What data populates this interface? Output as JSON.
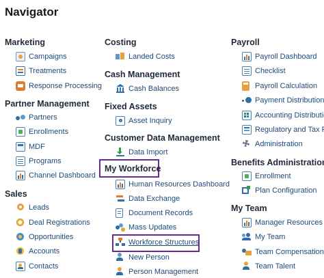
{
  "page": {
    "title": "Navigator"
  },
  "colors": {
    "link": "#1c4a78",
    "highlight": "#6a2a93",
    "heading": "#1f2a36"
  },
  "col1": {
    "marketing": {
      "title": "Marketing",
      "items": [
        {
          "label": "Campaigns",
          "icon": "campaigns-icon"
        },
        {
          "label": "Treatments",
          "icon": "treatments-icon"
        },
        {
          "label": "Response Processing",
          "icon": "response-processing-icon"
        }
      ]
    },
    "partner": {
      "title": "Partner Management",
      "items": [
        {
          "label": "Partners",
          "icon": "partners-icon"
        },
        {
          "label": "Enrollments",
          "icon": "enrollments-icon"
        },
        {
          "label": "MDF",
          "icon": "mdf-icon"
        },
        {
          "label": "Programs",
          "icon": "programs-icon"
        },
        {
          "label": "Channel Dashboard",
          "icon": "dashboard-icon"
        }
      ]
    },
    "sales": {
      "title": "Sales",
      "items": [
        {
          "label": "Leads",
          "icon": "leads-icon"
        },
        {
          "label": "Deal Registrations",
          "icon": "deal-registrations-icon"
        },
        {
          "label": "Opportunities",
          "icon": "opportunities-icon"
        },
        {
          "label": "Accounts",
          "icon": "accounts-icon"
        },
        {
          "label": "Contacts",
          "icon": "contacts-icon"
        }
      ]
    }
  },
  "col2": {
    "costing": {
      "title": "Costing",
      "items": [
        {
          "label": "Landed Costs",
          "icon": "landed-costs-icon"
        }
      ]
    },
    "cash": {
      "title": "Cash Management",
      "items": [
        {
          "label": "Cash Balances",
          "icon": "bank-icon"
        }
      ]
    },
    "fixed": {
      "title": "Fixed Assets",
      "items": [
        {
          "label": "Asset Inquiry",
          "icon": "asset-inquiry-icon"
        }
      ]
    },
    "cdm": {
      "title": "Customer Data Management",
      "items": [
        {
          "label": "Data Import",
          "icon": "download-icon"
        }
      ]
    },
    "workforce": {
      "title": "My Workforce",
      "items": [
        {
          "label": "Human Resources Dashboard",
          "icon": "dashboard-icon"
        },
        {
          "label": "Data Exchange",
          "icon": "data-exchange-icon"
        },
        {
          "label": "Document Records",
          "icon": "document-icon"
        },
        {
          "label": "Mass Updates",
          "icon": "mass-updates-icon"
        },
        {
          "label": "Workforce Structures",
          "icon": "workforce-structures-icon"
        },
        {
          "label": "New Person",
          "icon": "new-person-icon"
        },
        {
          "label": "Person Management",
          "icon": "person-management-icon"
        }
      ]
    }
  },
  "col3": {
    "payroll": {
      "title": "Payroll",
      "items": [
        {
          "label": "Payroll Dashboard",
          "icon": "dashboard-icon"
        },
        {
          "label": "Checklist",
          "icon": "checklist-icon"
        },
        {
          "label": "Payroll Calculation",
          "icon": "calculator-icon"
        },
        {
          "label": "Payment Distribution",
          "icon": "payment-distribution-icon"
        },
        {
          "label": "Accounting Distribution",
          "icon": "accounting-icon"
        },
        {
          "label": "Regulatory and Tax Re",
          "icon": "regulatory-icon"
        },
        {
          "label": "Administration",
          "icon": "gear-icon"
        }
      ]
    },
    "benefits": {
      "title": "Benefits Administration",
      "items": [
        {
          "label": "Enrollment",
          "icon": "enrollment-icon"
        },
        {
          "label": "Plan Configuration",
          "icon": "plan-configuration-icon"
        }
      ]
    },
    "team": {
      "title": "My Team",
      "items": [
        {
          "label": "Manager Resources D",
          "icon": "dashboard-icon"
        },
        {
          "label": "My Team",
          "icon": "team-icon"
        },
        {
          "label": "Team Compensation",
          "icon": "compensation-icon"
        },
        {
          "label": "Team Talent",
          "icon": "talent-icon"
        }
      ]
    }
  }
}
